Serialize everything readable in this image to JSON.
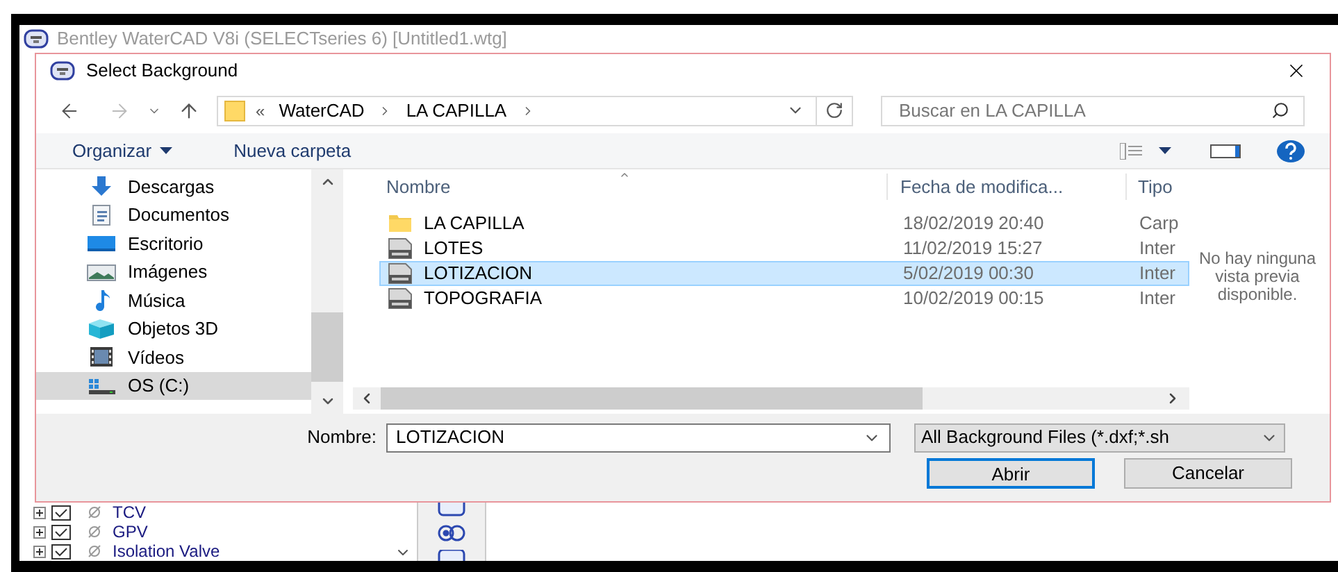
{
  "app": {
    "title": "Bentley WaterCAD V8i (SELECTseries 6) [Untitled1.wtg]",
    "tree": [
      {
        "label": "TCV",
        "checked": true
      },
      {
        "label": "GPV",
        "checked": true
      },
      {
        "label": "Isolation Valve",
        "checked": true
      }
    ]
  },
  "dialog": {
    "title": "Select Background",
    "address": {
      "overflow": "«",
      "segments": [
        "WaterCAD",
        "LA CAPILLA"
      ]
    },
    "search": {
      "placeholder": "Buscar en LA CAPILLA"
    },
    "toolbar": {
      "organize": "Organizar",
      "new_folder": "Nueva carpeta"
    },
    "nav": [
      {
        "label": "Descargas",
        "kind": "downloads",
        "selected": false
      },
      {
        "label": "Documentos",
        "kind": "documents",
        "selected": false
      },
      {
        "label": "Escritorio",
        "kind": "desktop",
        "selected": false
      },
      {
        "label": "Imágenes",
        "kind": "pictures",
        "selected": false
      },
      {
        "label": "Música",
        "kind": "music",
        "selected": false
      },
      {
        "label": "Objetos 3D",
        "kind": "objects3d",
        "selected": false
      },
      {
        "label": "Vídeos",
        "kind": "videos",
        "selected": false
      },
      {
        "label": "OS (C:)",
        "kind": "drive",
        "selected": true
      }
    ],
    "columns": [
      "Nombre",
      "Fecha de modifica...",
      "Tipo"
    ],
    "files": [
      {
        "name": "LA CAPILLA",
        "date": "18/02/2019 20:40",
        "type": "Carp",
        "kind": "folder",
        "selected": false
      },
      {
        "name": "LOTES",
        "date": "11/02/2019 15:27",
        "type": "Inter",
        "kind": "dxf",
        "selected": false
      },
      {
        "name": "LOTIZACION",
        "date": "5/02/2019 00:30",
        "type": "Inter",
        "kind": "dxf",
        "selected": true
      },
      {
        "name": "TOPOGRAFIA",
        "date": "10/02/2019 00:15",
        "type": "Inter",
        "kind": "dxf",
        "selected": false
      }
    ],
    "preview": "No hay ninguna vista previa disponible.",
    "filename": {
      "label": "Nombre:",
      "value": "LOTIZACION"
    },
    "filter": "All Background Files (*.dxf;*.sh",
    "buttons": [
      {
        "label": "Abrir",
        "default": true
      },
      {
        "label": "Cancelar",
        "default": false
      }
    ]
  }
}
